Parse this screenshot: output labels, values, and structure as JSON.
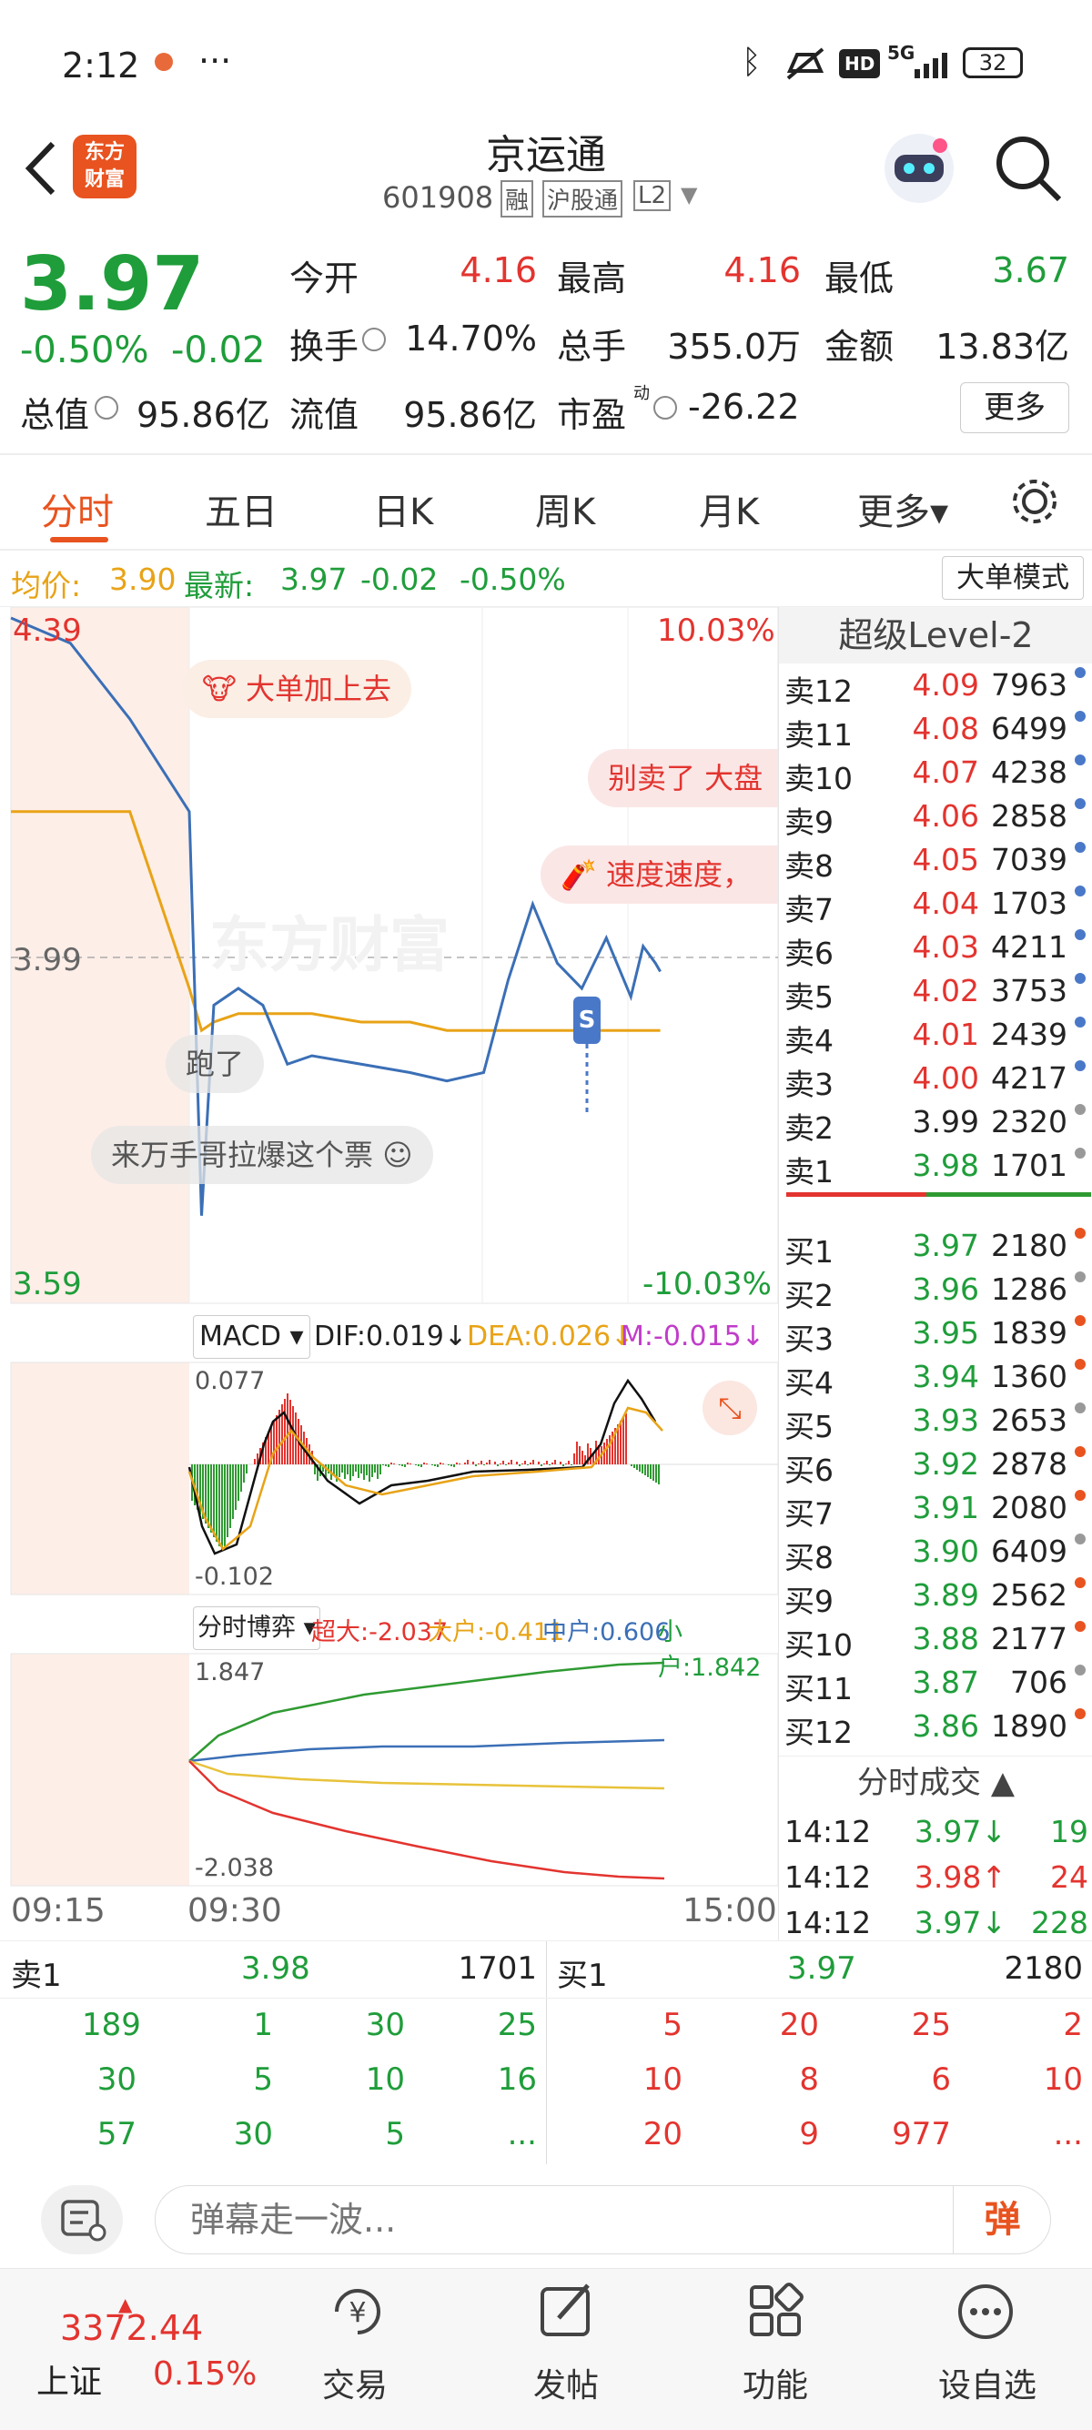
{
  "status": {
    "time": "2:12",
    "dots": "···",
    "battery": "32",
    "net": "5G",
    "hd": "HD"
  },
  "header": {
    "title": "京运通",
    "code": "601908",
    "tags": [
      "融",
      "沪股通",
      "L2"
    ],
    "logo_lines": [
      "东方",
      "财富"
    ]
  },
  "quote": {
    "price": "3.97",
    "pct": "-0.50%",
    "chg": "-0.02",
    "rows": [
      [
        {
          "k": "今开",
          "v": "4.16",
          "c": "red"
        },
        {
          "k": "最高",
          "v": "4.16",
          "c": "red"
        },
        {
          "k": "最低",
          "v": "3.67",
          "c": "green"
        }
      ],
      [
        {
          "k": "换手",
          "v": "14.70%",
          "c": "dark"
        },
        {
          "k": "总手",
          "v": "355.0万",
          "c": "dark"
        },
        {
          "k": "金额",
          "v": "13.83亿",
          "c": "dark"
        }
      ]
    ],
    "mktcap_label": "总值",
    "mktcap": "95.86亿",
    "float_label": "流值",
    "float": "95.86亿",
    "pe_label": "市盈",
    "pe_sup": "动",
    "pe": "-26.22",
    "more": "更多"
  },
  "tabs": [
    {
      "label": "分时",
      "active": true
    },
    {
      "label": "五日"
    },
    {
      "label": "日K"
    },
    {
      "label": "周K"
    },
    {
      "label": "月K"
    },
    {
      "label": "更多▾"
    }
  ],
  "summary": {
    "avg_label": "均价:",
    "avg": "3.90",
    "last_label": "最新:",
    "last": "3.97",
    "chg": "-0.02",
    "pct": "-0.50%",
    "mode_btn": "大单模式"
  },
  "chart": {
    "ymax": "4.39",
    "ymin": "3.59",
    "ymid": "3.99",
    "pct_top": "10.03%",
    "pct_bot": "-10.03%",
    "watermark": "东方财富",
    "x_labels": [
      "09:15",
      "09:30",
      "15:00"
    ],
    "sell_marker": "S"
  },
  "chart_data": {
    "type": "line",
    "series": [
      {
        "name": "price",
        "x": [
          "09:15",
          "09:20",
          "09:25",
          "09:30",
          "09:35",
          "09:40",
          "09:50",
          "10:00",
          "10:10",
          "10:20",
          "10:40",
          "11:00",
          "11:15",
          "11:30",
          "13:10",
          "13:20",
          "13:30",
          "13:40",
          "13:50",
          "14:00",
          "14:05",
          "14:10",
          "14:12"
        ],
        "values": [
          4.39,
          4.36,
          4.27,
          4.16,
          3.68,
          3.93,
          3.95,
          3.93,
          3.86,
          3.87,
          3.86,
          3.85,
          3.84,
          3.85,
          3.96,
          4.05,
          3.98,
          3.95,
          4.01,
          3.94,
          4.0,
          3.98,
          3.97
        ]
      },
      {
        "name": "avg",
        "values": [
          4.16,
          4.16,
          4.16,
          3.95,
          3.9,
          3.91,
          3.92,
          3.92,
          3.92,
          3.92,
          3.91,
          3.91,
          3.9,
          3.9,
          3.9,
          3.9,
          3.9,
          3.9,
          3.9,
          3.9,
          3.9,
          3.9,
          3.9
        ]
      }
    ],
    "ylim": [
      3.59,
      4.39
    ]
  },
  "macd": {
    "label": "MACD ▾",
    "dif": "DIF:0.019↓",
    "dea": "DEA:0.026↓",
    "m": "M:-0.015↓",
    "top": "0.077",
    "bot": "-0.102"
  },
  "fund": {
    "label": "分时博弈 ▾",
    "super": "超大:-2.037",
    "big": "大户:-0.411",
    "mid": "中户:0.606",
    "small": "小户:1.842",
    "top": "1.847",
    "bot": "-2.038"
  },
  "danmu": [
    "大单加上去",
    "别卖了 大盘",
    "速度速度，",
    "跑了",
    "来万手哥拉爆这个票"
  ],
  "orderbook": {
    "title": "超级Level-2",
    "asks": [
      [
        "卖12",
        "4.09",
        "7963"
      ],
      [
        "卖11",
        "4.08",
        "6499"
      ],
      [
        "卖10",
        "4.07",
        "4238"
      ],
      [
        "卖9",
        "4.06",
        "2858"
      ],
      [
        "卖8",
        "4.05",
        "7039"
      ],
      [
        "卖7",
        "4.04",
        "1703"
      ],
      [
        "卖6",
        "4.03",
        "4211"
      ],
      [
        "卖5",
        "4.02",
        "3753"
      ],
      [
        "卖4",
        "4.01",
        "2439"
      ],
      [
        "卖3",
        "4.00",
        "4217"
      ],
      [
        "卖2",
        "3.99",
        "2320"
      ],
      [
        "卖1",
        "3.98",
        "1701"
      ]
    ],
    "bids": [
      [
        "买1",
        "3.97",
        "2180"
      ],
      [
        "买2",
        "3.96",
        "1286"
      ],
      [
        "买3",
        "3.95",
        "1839"
      ],
      [
        "买4",
        "3.94",
        "1360"
      ],
      [
        "买5",
        "3.93",
        "2653"
      ],
      [
        "买6",
        "3.92",
        "2878"
      ],
      [
        "买7",
        "3.91",
        "2080"
      ],
      [
        "买8",
        "3.90",
        "6409"
      ],
      [
        "买9",
        "3.89",
        "2562"
      ],
      [
        "买10",
        "3.88",
        "2177"
      ],
      [
        "买11",
        "3.87",
        "706"
      ],
      [
        "买12",
        "3.86",
        "1890"
      ]
    ],
    "ticks_title": "分时成交",
    "ticks": [
      [
        "14:12",
        "3.97↓",
        "19"
      ],
      [
        "14:12",
        "3.98↑",
        "24"
      ],
      [
        "14:12",
        "3.97↓",
        "228"
      ]
    ]
  },
  "queue": {
    "sell_label": "卖1",
    "sell_price": "3.98",
    "sell_vol": "1701",
    "buy_label": "买1",
    "buy_price": "3.97",
    "buy_vol": "2180",
    "sell_rows": [
      [
        "189",
        "1",
        "30",
        "25"
      ],
      [
        "30",
        "5",
        "10",
        "16"
      ],
      [
        "57",
        "30",
        "5",
        "..."
      ]
    ],
    "buy_rows": [
      [
        "5",
        "20",
        "25",
        "2"
      ],
      [
        "10",
        "8",
        "6",
        "10"
      ],
      [
        "20",
        "9",
        "977",
        "..."
      ]
    ]
  },
  "input": {
    "placeholder": "弹幕走一波...",
    "danmu_btn": "弹"
  },
  "nav": {
    "index_value": "3372.44",
    "index_name": "上证",
    "index_pct": "0.15%",
    "items": [
      "交易",
      "发帖",
      "功能",
      "设自选"
    ]
  }
}
